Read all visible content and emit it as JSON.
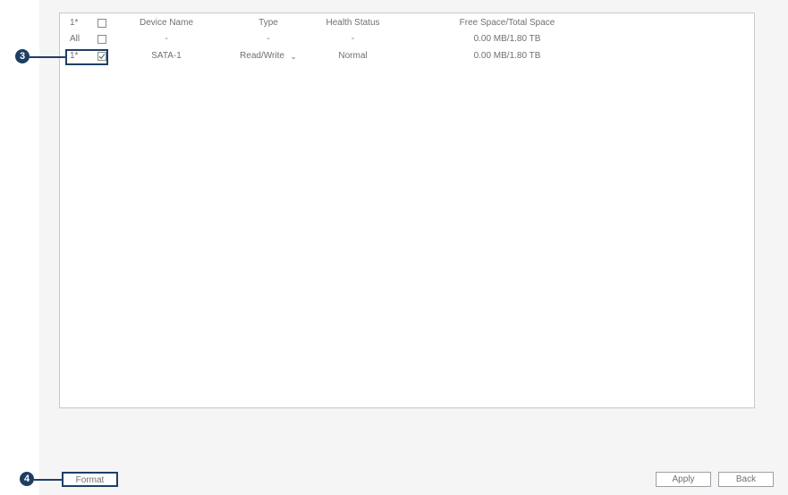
{
  "table": {
    "headers": {
      "no": "1*",
      "device_name": "Device Name",
      "type": "Type",
      "health_status": "Health Status",
      "space": "Free Space/Total Space"
    },
    "all_row": {
      "no": "All",
      "device_name": "-",
      "type": "-",
      "health_status": "-",
      "space": "0.00 MB/1.80 TB"
    },
    "rows": [
      {
        "no": "1*",
        "device_name": "SATA-1",
        "type": "Read/Write",
        "type_chevron": "⌄",
        "health_status": "Normal",
        "space": "0.00 MB/1.80 TB",
        "checked": true
      }
    ]
  },
  "callouts": {
    "three": "3",
    "four": "4"
  },
  "buttons": {
    "format": "Format",
    "apply": "Apply",
    "back": "Back"
  },
  "colors": {
    "panel_bg": "#f5f5f5",
    "callout": "#1e3d63",
    "text": "#707070"
  }
}
